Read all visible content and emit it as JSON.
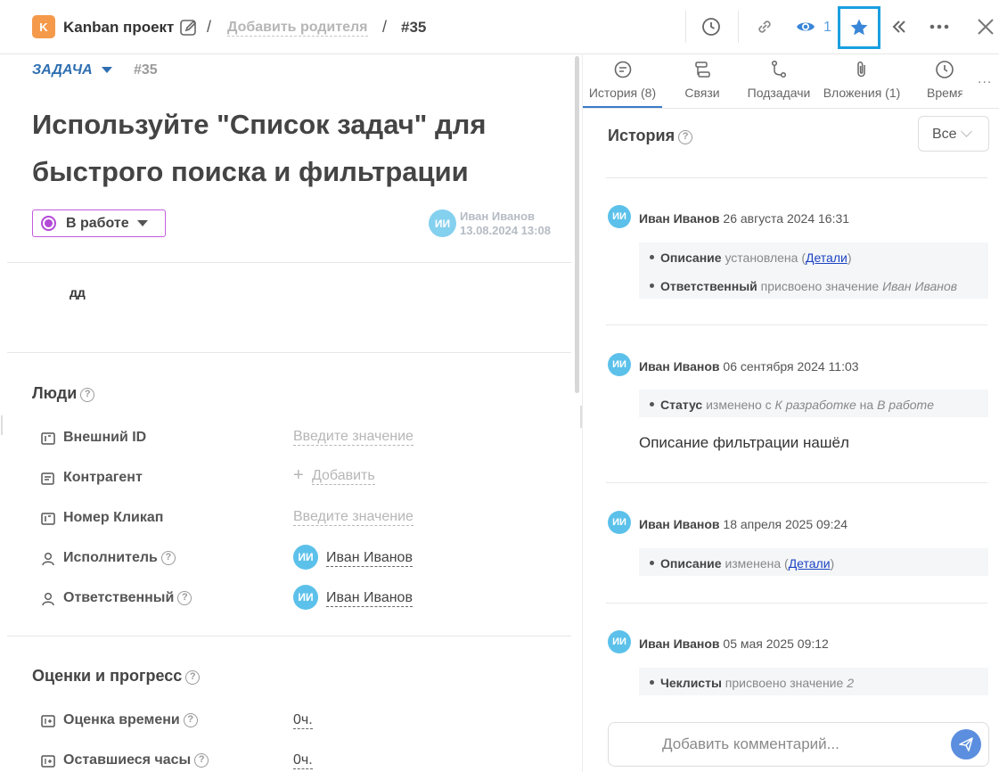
{
  "header": {
    "project_badge": "K",
    "project_name": "Kanban проект",
    "separator": "/",
    "add_parent": "Добавить родителя",
    "task_number": "#35",
    "watchers_count": "1"
  },
  "task": {
    "type": "ЗАДАЧА",
    "number": "#35",
    "title": "Используйте \"Список задач\" для быстрого поиска и фильтрации",
    "status": "В работе",
    "author_initials": "ИИ",
    "author_name": "Иван Иванов",
    "author_date": "13.08.2024 13:08",
    "description": "дд"
  },
  "people": {
    "title": "Люди",
    "fields": [
      {
        "label": "Внешний ID",
        "value": "Введите значение",
        "icon": "id-card-icon"
      },
      {
        "label": "Контрагент",
        "plus": "+",
        "value": "Добавить",
        "icon": "contact-card-icon"
      },
      {
        "label": "Номер Кликап",
        "value": "Введите значение",
        "icon": "id-card-icon"
      },
      {
        "label": "Исполнитель",
        "initials": "ИИ",
        "value": "Иван Иванов",
        "icon": "person-icon"
      },
      {
        "label": "Ответственный",
        "initials": "ИИ",
        "value": "Иван Иванов",
        "icon": "person-icon"
      }
    ]
  },
  "estimates": {
    "title": "Оценки и прогресс",
    "fields": [
      {
        "label": "Оценка времени",
        "value": "0ч.",
        "icon": "number-icon"
      },
      {
        "label": "Оставшиеся часы",
        "value": "0ч.",
        "icon": "number-icon"
      }
    ]
  },
  "tabs": [
    {
      "label": "История (8)",
      "icon": "chat-icon"
    },
    {
      "label": "Связи",
      "icon": "links-icon"
    },
    {
      "label": "Подзадачи",
      "icon": "subtasks-icon"
    },
    {
      "label": "Вложения (1)",
      "icon": "paperclip-icon"
    },
    {
      "label": "Время",
      "icon": "clock-icon"
    }
  ],
  "more_tabs": "...",
  "history": {
    "title": "История",
    "filter": "Все",
    "entries": [
      {
        "initials": "ИИ",
        "author": "Иван Иванов",
        "date": "26 августа 2024 16:31",
        "lines": [
          {
            "field": "Описание",
            "text": "установлена",
            "open": "(",
            "link": "Детали",
            "close": ")"
          },
          {
            "field": "Ответственный",
            "text": "присвоено значение",
            "value": "Иван Иванов"
          }
        ]
      },
      {
        "initials": "ИИ",
        "author": "Иван Иванов",
        "date": "06 сентября 2024 11:03",
        "lines": [
          {
            "field": "Статус",
            "text": "изменено с",
            "from": "К разработке",
            "mid": "на",
            "to": "В работе"
          }
        ],
        "comment": "Описание фильтрации нашёл"
      },
      {
        "initials": "ИИ",
        "author": "Иван Иванов",
        "date": "18 апреля 2025 09:24",
        "lines": [
          {
            "field": "Описание",
            "text": "изменена",
            "open": "(",
            "link": "Детали",
            "close": ")"
          }
        ]
      },
      {
        "initials": "ИИ",
        "author": "Иван Иванов",
        "date": "05 мая 2025 09:12",
        "lines": [
          {
            "field": "Чеклисты",
            "text": "присвоено значение",
            "value": "2"
          }
        ]
      }
    ]
  },
  "comment": {
    "placeholder": "Добавить комментарий..."
  },
  "colors": {
    "accent": "#2f6fb1",
    "status": "#b44ad8",
    "avatar": "#5cc1ea",
    "highlight": "#1a9fe0"
  }
}
